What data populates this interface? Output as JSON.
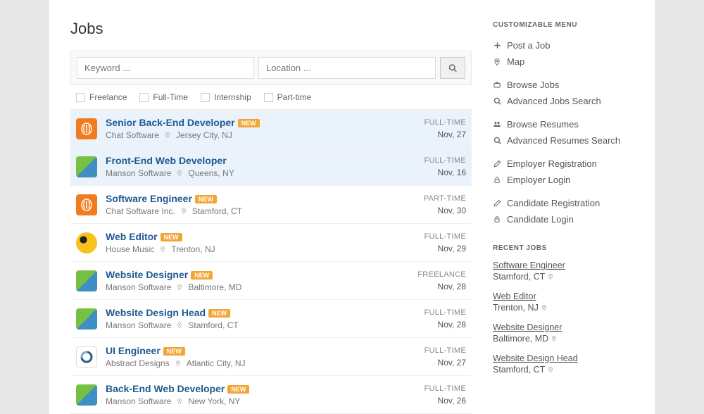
{
  "title": "Jobs",
  "search": {
    "keyword_placeholder": "Keyword ...",
    "location_placeholder": "Location ..."
  },
  "filters": [
    {
      "label": "Freelance"
    },
    {
      "label": "Full-Time"
    },
    {
      "label": "Internship"
    },
    {
      "label": "Part-time"
    }
  ],
  "jobs": [
    {
      "title": "Senior Back-End Developer",
      "badge": "NEW",
      "company": "Chat Software",
      "location": "Jersey City, NJ",
      "type": "FULL-TIME",
      "date": "Nov, 27",
      "logo": "orange",
      "hl": true
    },
    {
      "title": "Front-End Web Developer",
      "badge": "",
      "company": "Manson Software",
      "location": "Queens, NY",
      "type": "FULL-TIME",
      "date": "Nov, 16",
      "logo": "green",
      "hl": true
    },
    {
      "title": "Software Engineer",
      "badge": "NEW",
      "company": "Chat Software Inc.",
      "location": "Stamford, CT",
      "type": "PART-TIME",
      "date": "Nov, 30",
      "logo": "orange",
      "hl": false
    },
    {
      "title": "Web Editor",
      "badge": "NEW",
      "company": "House Music",
      "location": "Trenton, NJ",
      "type": "FULL-TIME",
      "date": "Nov, 29",
      "logo": "yellow",
      "hl": false
    },
    {
      "title": "Website Designer",
      "badge": "NEW",
      "company": "Manson Software",
      "location": "Baltimore, MD",
      "type": "FREELANCE",
      "date": "Nov, 28",
      "logo": "green",
      "hl": false
    },
    {
      "title": "Website Design Head",
      "badge": "NEW",
      "company": "Manson Software",
      "location": "Stamford, CT",
      "type": "FULL-TIME",
      "date": "Nov, 28",
      "logo": "green",
      "hl": false
    },
    {
      "title": "UI Engineer",
      "badge": "NEW",
      "company": "Abstract Designs",
      "location": "Atlantic City, NJ",
      "type": "FULL-TIME",
      "date": "Nov, 27",
      "logo": "blue",
      "hl": false
    },
    {
      "title": "Back-End Web Developer",
      "badge": "NEW",
      "company": "Manson Software",
      "location": "New York, NY",
      "type": "FULL-TIME",
      "date": "Nov, 26",
      "logo": "green",
      "hl": false
    }
  ],
  "sidebar": {
    "menu_heading": "Customizable Menu",
    "menu": [
      {
        "icon": "plus",
        "label": "Post a Job"
      },
      {
        "icon": "pin",
        "label": "Map"
      },
      {
        "spacer": true
      },
      {
        "icon": "brief",
        "label": "Browse Jobs"
      },
      {
        "icon": "search",
        "label": "Advanced Jobs Search"
      },
      {
        "spacer": true
      },
      {
        "icon": "users",
        "label": "Browse Resumes"
      },
      {
        "icon": "search",
        "label": "Advanced Resumes Search"
      },
      {
        "spacer": true
      },
      {
        "icon": "pencil",
        "label": "Employer Registration"
      },
      {
        "icon": "lock",
        "label": "Employer Login"
      },
      {
        "spacer": true
      },
      {
        "icon": "pencil",
        "label": "Candidate Registration"
      },
      {
        "icon": "lock",
        "label": "Candidate Login"
      }
    ],
    "recent_heading": "Recent Jobs",
    "recent": [
      {
        "title": "Software Engineer",
        "location": "Stamford, CT"
      },
      {
        "title": "Web Editor",
        "location": "Trenton, NJ"
      },
      {
        "title": "Website Designer",
        "location": "Baltimore, MD"
      },
      {
        "title": "Website Design Head",
        "location": "Stamford, CT"
      }
    ]
  }
}
